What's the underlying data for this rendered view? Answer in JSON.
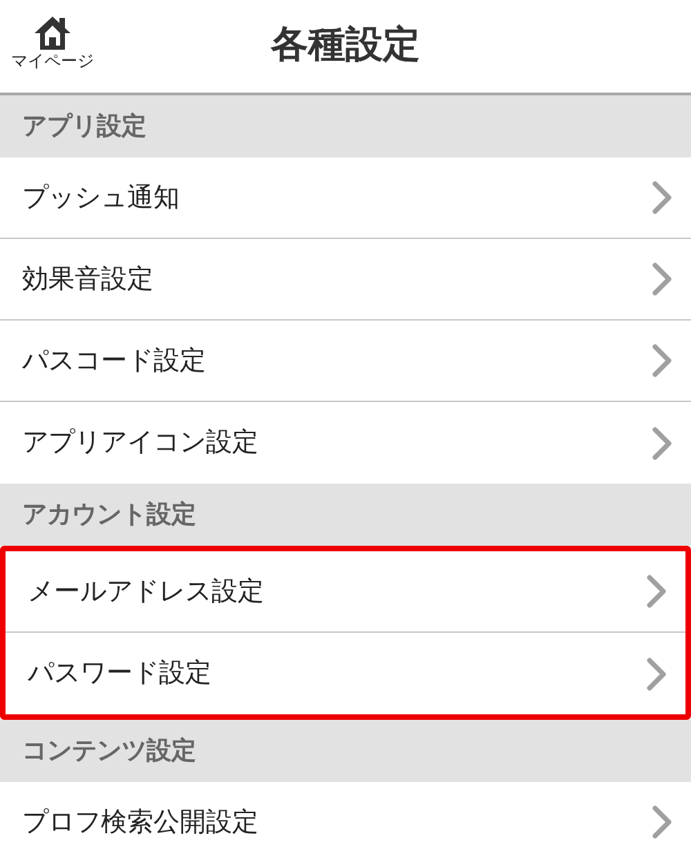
{
  "header": {
    "home_label": "マイページ",
    "title": "各種設定"
  },
  "sections": [
    {
      "title": "アプリ設定",
      "items": [
        {
          "label": "プッシュ通知",
          "highlighted": false
        },
        {
          "label": "効果音設定",
          "highlighted": false
        },
        {
          "label": "パスコード設定",
          "highlighted": false
        },
        {
          "label": "アプリアイコン設定",
          "highlighted": false
        }
      ]
    },
    {
      "title": "アカウント設定",
      "items": [
        {
          "label": "メールアドレス設定",
          "highlighted": true
        },
        {
          "label": "パスワード設定",
          "highlighted": true
        }
      ]
    },
    {
      "title": "コンテンツ設定",
      "items": [
        {
          "label": "プロフ検索公開設定",
          "highlighted": false
        }
      ]
    }
  ]
}
